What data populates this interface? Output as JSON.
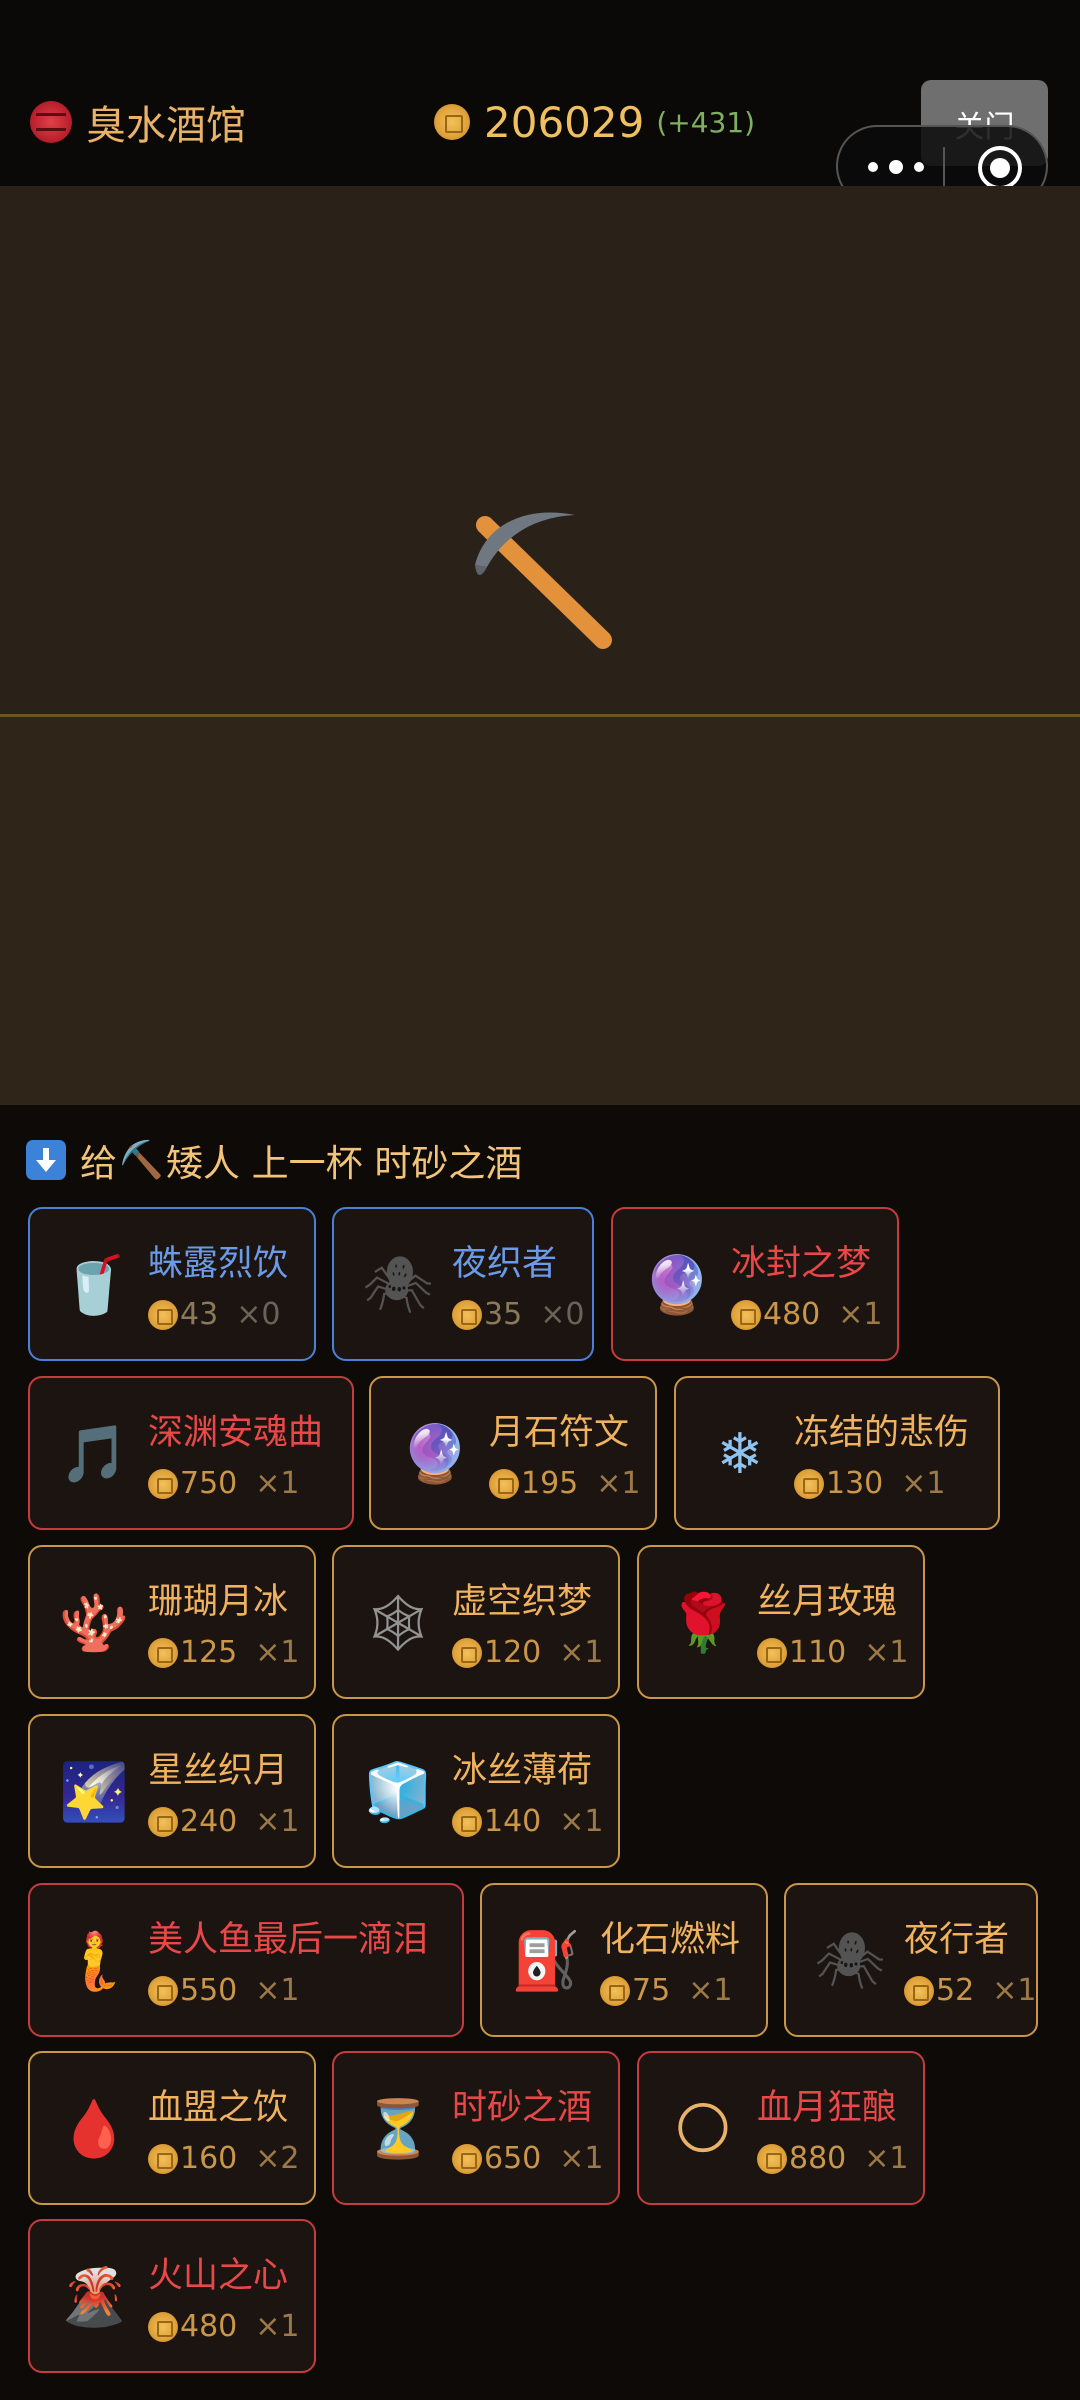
{
  "header": {
    "tavern_name": "臭水酒馆",
    "coins": "206029",
    "coins_delta": "(+431)",
    "close_label": "关门"
  },
  "scene": {
    "icon": "pickaxe-icon"
  },
  "prompt": {
    "prefix": "给",
    "pick_glyph": "⛏️",
    "target": "矮人 上一杯 时砂之酒"
  },
  "drinks": [
    {
      "name": "蛛露烈饮",
      "price": "43",
      "qty": "×0",
      "style": "blue",
      "icon": "tumbler-glass-icon",
      "glyph": "🥤"
    },
    {
      "name": "夜织者",
      "price": "35",
      "qty": "×0",
      "style": "blue",
      "icon": "spider-icon",
      "glyph": "🕷"
    },
    {
      "name": "冰封之梦",
      "price": "480",
      "qty": "×1",
      "style": "red",
      "icon": "crystal-ball-icon",
      "glyph": "🔮"
    },
    {
      "name": "深渊安魂曲",
      "price": "750",
      "qty": "×1",
      "style": "red",
      "icon": "music-note-icon",
      "glyph": "🎵"
    },
    {
      "name": "月石符文",
      "price": "195",
      "qty": "×1",
      "style": "gold",
      "icon": "crystal-ball-icon",
      "glyph": "🔮"
    },
    {
      "name": "冻结的悲伤",
      "price": "130",
      "qty": "×1",
      "style": "gold",
      "icon": "snowflake-icon",
      "glyph": "❄"
    },
    {
      "name": "珊瑚月冰",
      "price": "125",
      "qty": "×1",
      "style": "gold",
      "icon": "coral-icon",
      "glyph": "🪸"
    },
    {
      "name": "虚空织梦",
      "price": "120",
      "qty": "×1",
      "style": "gold",
      "icon": "spider-web-icon",
      "glyph": "🕸"
    },
    {
      "name": "丝月玫瑰",
      "price": "110",
      "qty": "×1",
      "style": "gold",
      "icon": "rose-icon",
      "glyph": "🌹"
    },
    {
      "name": "星丝织月",
      "price": "240",
      "qty": "×1",
      "style": "gold",
      "icon": "shooting-star-icon",
      "glyph": "🌠"
    },
    {
      "name": "冰丝薄荷",
      "price": "140",
      "qty": "×1",
      "style": "gold",
      "icon": "ice-cube-icon",
      "glyph": "🧊"
    },
    {
      "name": "美人鱼最后一滴泪",
      "price": "550",
      "qty": "×1",
      "style": "red",
      "icon": "mermaid-icon",
      "glyph": "🧜"
    },
    {
      "name": "化石燃料",
      "price": "75",
      "qty": "×1",
      "style": "gold",
      "icon": "fuel-pump-icon",
      "glyph": "⛽"
    },
    {
      "name": "夜行者",
      "price": "52",
      "qty": "×1",
      "style": "gold",
      "icon": "spider-icon",
      "glyph": "🕷"
    },
    {
      "name": "血盟之饮",
      "price": "160",
      "qty": "×2",
      "style": "gold",
      "icon": "blood-drop-icon",
      "glyph": "🩸"
    },
    {
      "name": "时砂之酒",
      "price": "650",
      "qty": "×1",
      "style": "red",
      "icon": "hourglass-icon",
      "glyph": "⏳"
    },
    {
      "name": "血月狂酿",
      "price": "880",
      "qty": "×1",
      "style": "red",
      "icon": "full-moon-icon",
      "glyph": "🌕"
    },
    {
      "name": "火山之心",
      "price": "480",
      "qty": "×1",
      "style": "red",
      "icon": "volcano-icon",
      "glyph": "🌋"
    }
  ]
}
